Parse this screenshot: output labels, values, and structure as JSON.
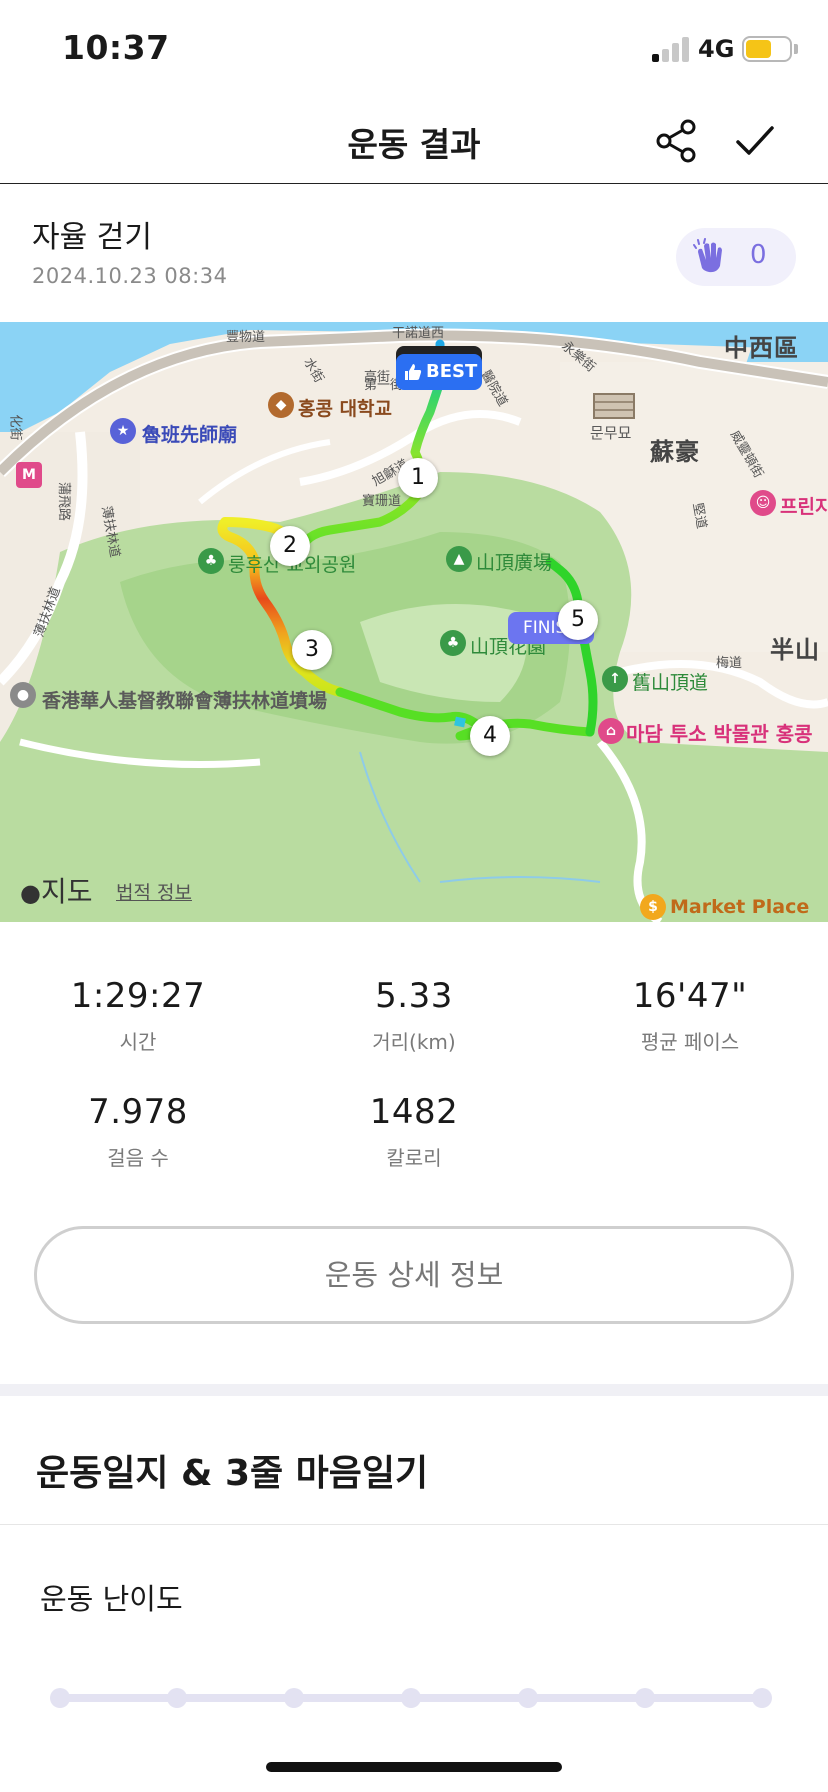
{
  "status_bar": {
    "time": "10:37",
    "network": "4G",
    "battery_level": 0.6
  },
  "header": {
    "title": "운동 결과",
    "share_icon": "share-icon",
    "done_icon": "check-icon"
  },
  "activity": {
    "name": "자율 걷기",
    "date": "2024.10.23 08:34",
    "clap_count": "0"
  },
  "map": {
    "badges": {
      "best": "BEST",
      "finish": "FINISH"
    },
    "km_markers": [
      "1",
      "2",
      "3",
      "4",
      "5"
    ],
    "labels": {
      "hku": "홍콩 대학교",
      "lu_ban": "魯班先師廟",
      "lung_fu_shan": "룽후산 교외공원",
      "mo_mo": "문무묘",
      "so_ho": "蘇豪",
      "central_western": "中西區",
      "peak_plaza": "山頂廣場",
      "peak_garden": "山頂花園",
      "old_peak_road": "舊山頂道",
      "madame_tussauds": "마담 투소 박물관 홍콩",
      "cemetery": "香港華人基督教聯會薄扶林道墳場",
      "bun_shan": "半山",
      "prince": "프린지",
      "market": "Market Place"
    },
    "streets": [
      "豐物道",
      "干諾道西",
      "第一街",
      "高街",
      "水街",
      "醫院道",
      "永樂街",
      "旭龢道",
      "寶珊道",
      "薄扶林道",
      "蒲飛路",
      "化街",
      "堅道",
      "威靈頓街",
      "梅道",
      "薄扶林道"
    ],
    "brand": "지도",
    "legal": "법적 정보"
  },
  "stats": [
    {
      "value": "1:29:27",
      "label": "시간"
    },
    {
      "value": "5.33",
      "label": "거리(km)"
    },
    {
      "value": "16'47\"",
      "label": "평균 페이스"
    },
    {
      "value": "7.978",
      "label": "걸음 수"
    },
    {
      "value": "1482",
      "label": "칼로리"
    }
  ],
  "detail_button": "운동 상세 정보",
  "journal": {
    "title": "운동일지 & 3줄 마음일기",
    "difficulty_title": "운동 난이도",
    "difficulty_levels": 7
  }
}
